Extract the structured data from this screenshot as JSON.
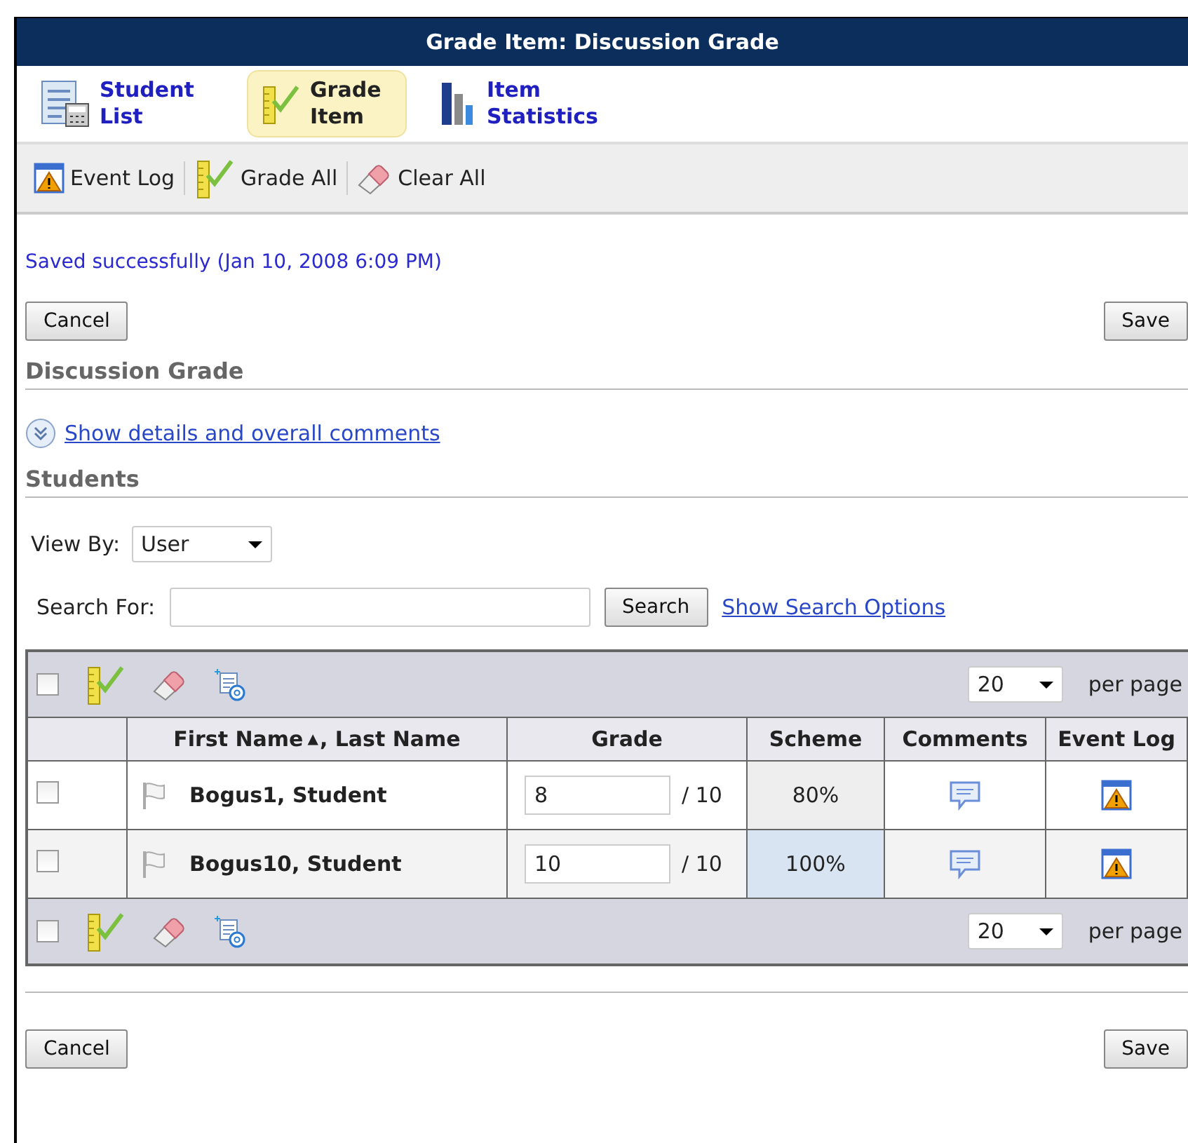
{
  "title": "Grade Item: Discussion Grade",
  "nav_tabs": [
    {
      "label": "Student List",
      "selected": false
    },
    {
      "label": "Grade Item",
      "selected": true
    },
    {
      "label": "Item Statistics",
      "selected": false
    }
  ],
  "toolbar": [
    {
      "label": "Event Log"
    },
    {
      "label": "Grade All"
    },
    {
      "label": "Clear All"
    }
  ],
  "message": "Saved successfully (Jan 10, 2008 6:09 PM)",
  "top_buttons": [
    "Cancel",
    "Save"
  ],
  "section_title": "Discussion Grade",
  "details_link": "Show details and overall comments",
  "students_heading": "Students",
  "view_by": {
    "label": "View By:",
    "value": "User"
  },
  "search": {
    "label": "Search For:",
    "button": "Search",
    "options_link": "Show Search Options"
  },
  "table": {
    "toolbar": {
      "checked": false,
      "per_page_value": "20",
      "per_page_label": "per page"
    },
    "columns": [
      {
        "label": "First Name",
        "sort_mark": "▲",
        "suffix": ", Last Name"
      },
      {
        "label": "Grade"
      },
      {
        "label": "Scheme"
      },
      {
        "label": "Comments"
      },
      {
        "label": "Event Log"
      }
    ],
    "rows": [
      {
        "checked": false,
        "name": "Bogus1, Student",
        "grade": "8",
        "out_of": "/ 10",
        "scheme": "80%",
        "scheme_highlighted": false
      },
      {
        "checked": false,
        "name": "Bogus10, Student",
        "grade": "10",
        "out_of": "/ 10",
        "scheme": "100%",
        "scheme_highlighted": true
      }
    ],
    "footer": {
      "checked": false,
      "per_page_value": "20",
      "per_page_label": "per page"
    }
  },
  "bottom_buttons": [
    "Cancel",
    "Save"
  ]
}
